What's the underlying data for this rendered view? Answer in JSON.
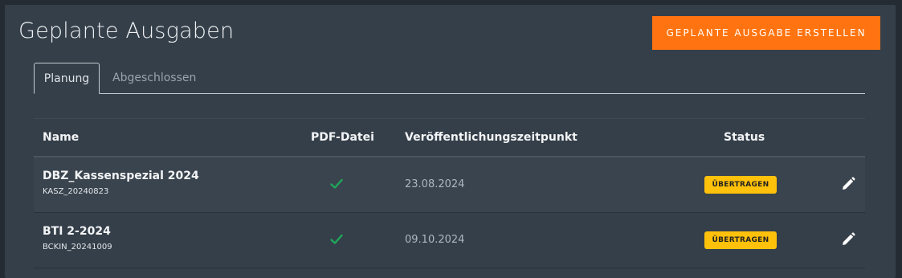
{
  "page": {
    "title": "Geplante Ausgaben",
    "create_button_label": "GEPLANTE AUSGABE ERSTELLEN"
  },
  "tabs": [
    {
      "label": "Planung",
      "active": true
    },
    {
      "label": "Abgeschlossen",
      "active": false
    }
  ],
  "table": {
    "columns": {
      "name": "Name",
      "pdf": "PDF-Datei",
      "published": "Veröffentlichungszeitpunkt",
      "status": "Status"
    },
    "rows": [
      {
        "name": "DBZ_Kassenspezial 2024",
        "code": "KASZ_20240823",
        "pdf_icon": "check-icon",
        "date": "23.08.2024",
        "status": "ÜBERTRAGEN",
        "edit_icon": "pencil-icon"
      },
      {
        "name": "BTI 2-2024",
        "code": "BCKIN_20241009",
        "pdf_icon": "check-icon",
        "date": "09.10.2024",
        "status": "ÜBERTRAGEN",
        "edit_icon": "pencil-icon"
      }
    ]
  },
  "colors": {
    "accent": "#ff7410",
    "status_badge": "#ffc10a",
    "check": "#1fa85a",
    "panel": "#353f49"
  }
}
